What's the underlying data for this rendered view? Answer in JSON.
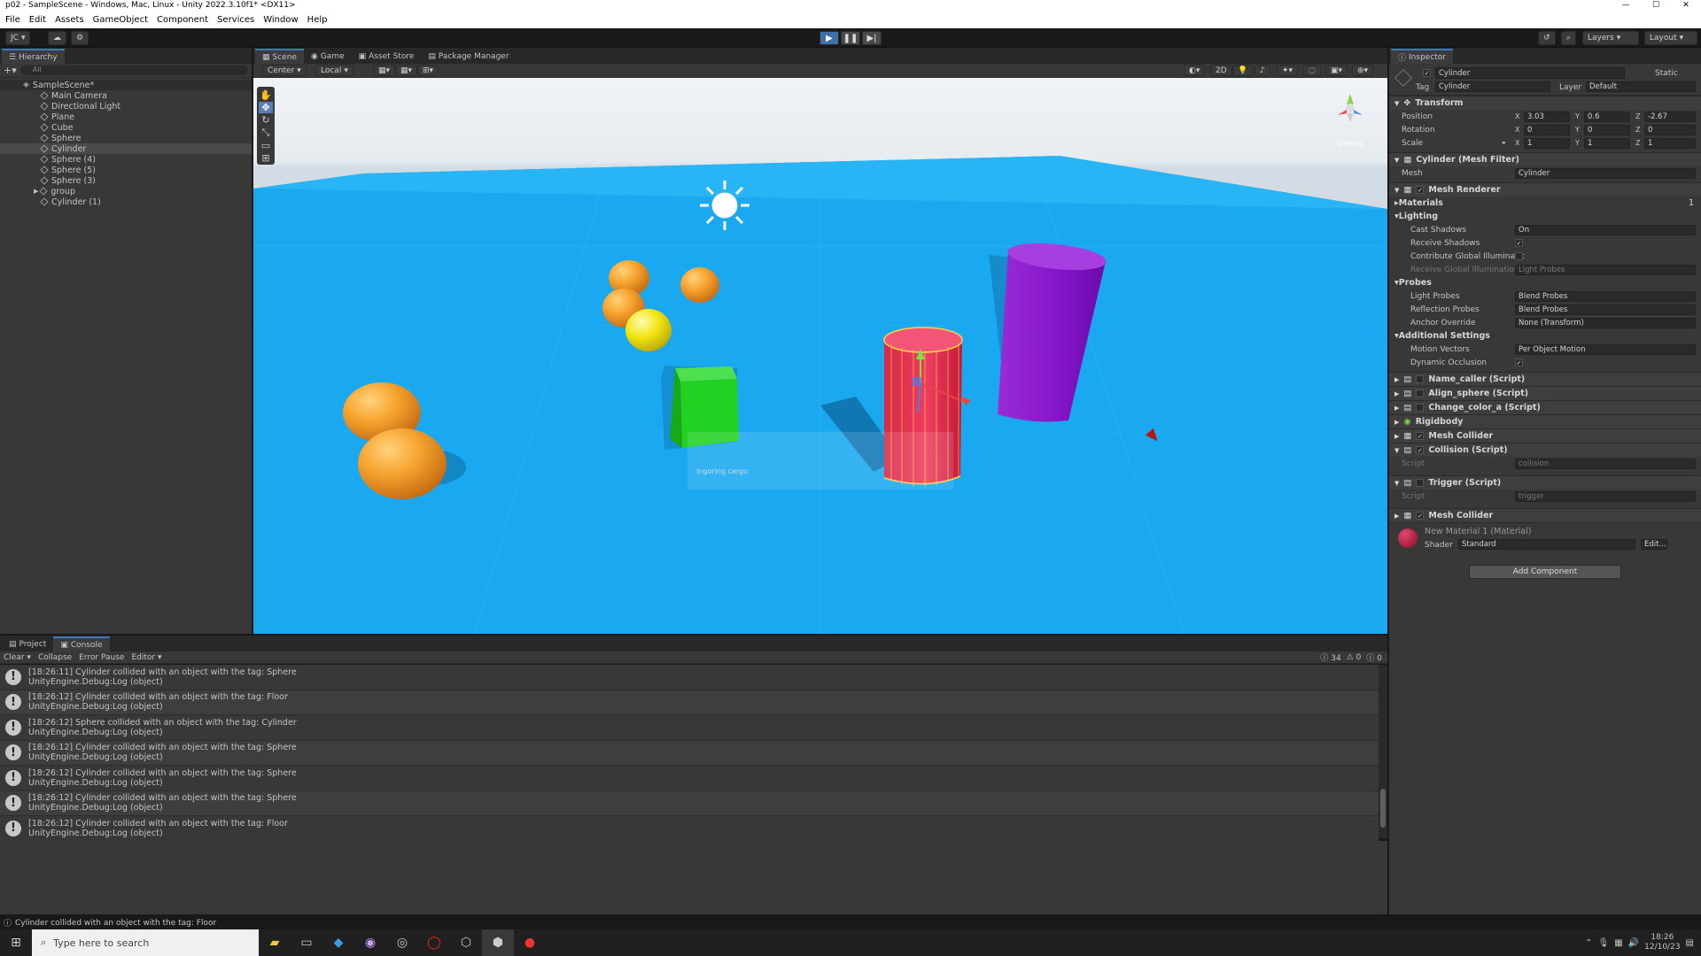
{
  "window": {
    "title": "p02 - SampleScene - Windows, Mac, Linux - Unity 2022.3.10f1* <DX11>"
  },
  "menu": [
    "File",
    "Edit",
    "Assets",
    "GameObject",
    "Component",
    "Services",
    "Window",
    "Help"
  ],
  "toolbar": {
    "account": "JC",
    "layers": "Layers",
    "layout": "Layout"
  },
  "hierarchy": {
    "tab": "Hierarchy",
    "search_placeholder": "All",
    "scene": "SampleScene*",
    "items": [
      {
        "label": "Main Camera"
      },
      {
        "label": "Directional Light"
      },
      {
        "label": "Plane"
      },
      {
        "label": "Cube"
      },
      {
        "label": "Sphere"
      },
      {
        "label": "Cylinder"
      },
      {
        "label": "Sphere (4)"
      },
      {
        "label": "Sphere (5)"
      },
      {
        "label": "Sphere (3)"
      },
      {
        "label": "group"
      },
      {
        "label": "Cylinder (1)"
      }
    ]
  },
  "center_tabs": [
    "Scene",
    "Game",
    "Asset Store",
    "Package Manager"
  ],
  "scene_toolbar": {
    "pivot": "Center",
    "space": "Local",
    "mode_2d": "2D",
    "persp": "< Persp"
  },
  "scene_overlay": {
    "text": "Ingoring cargo"
  },
  "inspector": {
    "tab": "Inspector",
    "object_name": "Cylinder",
    "static": "Static",
    "tag_label": "Tag",
    "tag": "Cylinder",
    "layer_label": "Layer",
    "layer": "Default",
    "transform": {
      "title": "Transform",
      "position_label": "Position",
      "position": {
        "x": "3.03",
        "y": "0.6",
        "z": "-2.67"
      },
      "rotation_label": "Rotation",
      "rotation": {
        "x": "0",
        "y": "0",
        "z": "0"
      },
      "scale_label": "Scale",
      "scale": {
        "x": "1",
        "y": "1",
        "z": "1"
      }
    },
    "mesh_filter": {
      "title": "Cylinder (Mesh Filter)",
      "mesh_label": "Mesh",
      "mesh": "Cylinder"
    },
    "mesh_renderer": {
      "title": "Mesh Renderer",
      "materials": "Materials",
      "materials_count": "1",
      "lighting": "Lighting",
      "cast_shadows_label": "Cast Shadows",
      "cast_shadows": "On",
      "receive_shadows_label": "Receive Shadows",
      "contribute_gi_label": "Contribute Global Illuminatic",
      "receive_gi_label": "Receive Global Illumination",
      "receive_gi": "Light Probes",
      "probes": "Probes",
      "light_probes_label": "Light Probes",
      "light_probes": "Blend Probes",
      "reflection_probes_label": "Reflection Probes",
      "reflection_probes": "Blend Probes",
      "anchor_override_label": "Anchor Override",
      "anchor_override": "None (Transform)",
      "additional": "Additional Settings",
      "motion_vectors_label": "Motion Vectors",
      "motion_vectors": "Per Object Motion",
      "dynamic_occlusion_label": "Dynamic Occlusion"
    },
    "components": [
      "Name_caller (Script)",
      "Align_sphere (Script)",
      "Change_color_a (Script)",
      "Rigidbody",
      "Mesh Collider",
      "Collision (Script)"
    ],
    "collision_script_label": "Script",
    "collision_script": "collision",
    "trigger": {
      "title": "Trigger (Script)",
      "script_label": "Script",
      "script": "trigger"
    },
    "mesh_collider2": "Mesh Collider",
    "material": {
      "name": "New Material 1 (Material)",
      "shader_label": "Shader",
      "shader": "Standard",
      "edit": "Edit..."
    },
    "add_component": "Add Component"
  },
  "bottom_tabs": [
    "Project",
    "Console"
  ],
  "console": {
    "buttons": [
      "Clear",
      "Collapse",
      "Error Pause",
      "Editor"
    ],
    "counts": {
      "log": "34",
      "warn": "0",
      "error": "0"
    },
    "messages": [
      {
        "line1": "[18:26:11] Cylinder collided with an object with the tag: Sphere",
        "line2": "UnityEngine.Debug:Log (object)"
      },
      {
        "line1": "[18:26:12] Cylinder collided with an object with the tag: Floor",
        "line2": "UnityEngine.Debug:Log (object)"
      },
      {
        "line1": "[18:26:12] Sphere collided with an object with the tag: Cylinder",
        "line2": "UnityEngine.Debug:Log (object)"
      },
      {
        "line1": "[18:26:12] Cylinder collided with an object with the tag: Sphere",
        "line2": "UnityEngine.Debug:Log (object)"
      },
      {
        "line1": "[18:26:12] Cylinder collided with an object with the tag: Sphere",
        "line2": "UnityEngine.Debug:Log (object)"
      },
      {
        "line1": "[18:26:12] Cylinder collided with an object with the tag: Sphere",
        "line2": "UnityEngine.Debug:Log (object)"
      },
      {
        "line1": "[18:26:12] Cylinder collided with an object with the tag: Floor",
        "line2": "UnityEngine.Debug:Log (object)"
      }
    ]
  },
  "status_bar": {
    "text": "Cylinder collided with an object with the tag: Floor"
  },
  "taskbar": {
    "search_placeholder": "Type here to search",
    "time": "18:26",
    "date": "12/10/23"
  }
}
